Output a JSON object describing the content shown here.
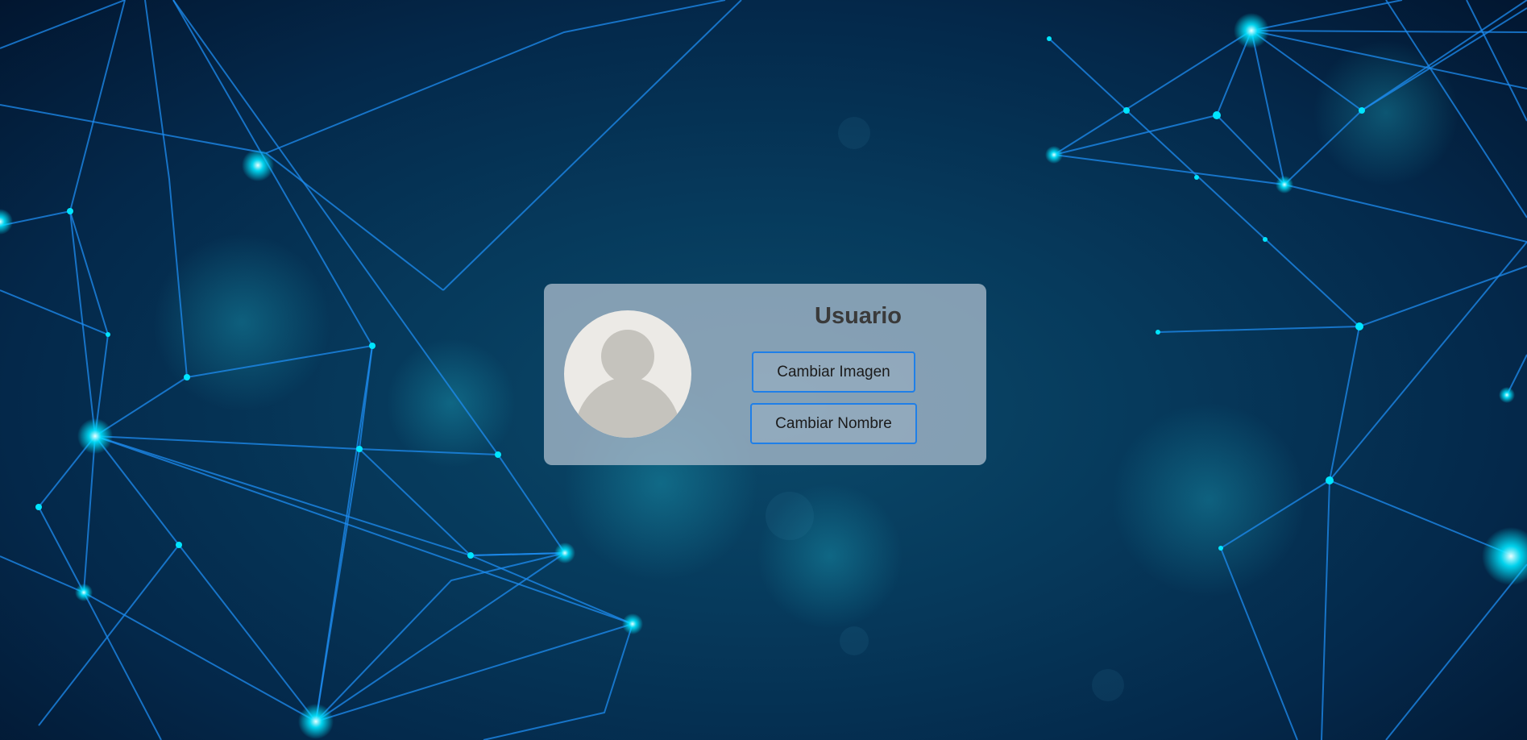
{
  "background": {
    "style": "network-constellation",
    "colors": {
      "base": "#04284a",
      "line": "#1e90ff",
      "node": "#00e5ff"
    }
  },
  "card": {
    "avatar_icon": "user-placeholder-icon",
    "title": "Usuario",
    "change_image_label": "Cambiar Imagen",
    "change_name_label": "Cambiar Nombre",
    "accent": "#1f7fe8"
  }
}
